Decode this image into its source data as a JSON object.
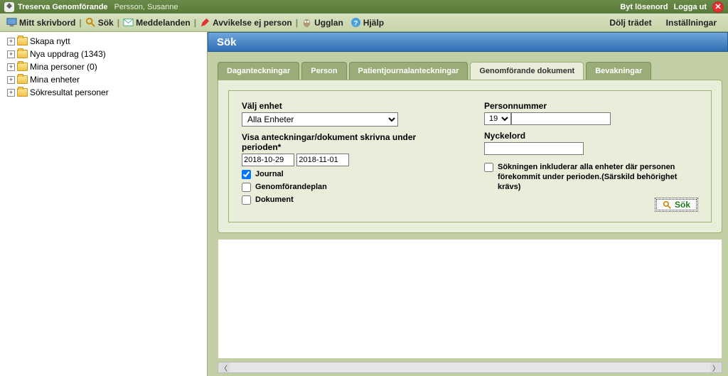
{
  "titlebar": {
    "app_name": "Treserva Genomförande",
    "user": "Persson, Susanne",
    "change_password": "Byt lösenord",
    "logout": "Logga ut"
  },
  "toolbar": {
    "desktop": "Mitt skrivbord",
    "search": "Sök",
    "messages": "Meddelanden",
    "deviation": "Avvikelse ej person",
    "owl": "Ugglan",
    "help": "Hjälp",
    "hide_tree": "Dölj trädet",
    "settings": "Inställningar"
  },
  "tree": {
    "items": [
      {
        "label": "Skapa nytt"
      },
      {
        "label": "Nya uppdrag (1343)"
      },
      {
        "label": "Mina personer (0)"
      },
      {
        "label": "Mina enheter"
      },
      {
        "label": "Sökresultat personer"
      }
    ]
  },
  "panel": {
    "title": "Sök"
  },
  "tabs": {
    "items": [
      {
        "label": "Daganteckningar"
      },
      {
        "label": "Person"
      },
      {
        "label": "Patientjournalanteckningar"
      },
      {
        "label": "Genomförande dokument"
      },
      {
        "label": "Bevakningar"
      }
    ],
    "active": 3
  },
  "form": {
    "unit_label": "Välj enhet",
    "unit_value": "Alla Enheter",
    "period_label": "Visa anteckningar/dokument skrivna under perioden*",
    "date_from": "2018-10-29",
    "date_to": "2018-11-01",
    "journal": "Journal",
    "plan": "Genomförandeplan",
    "document": "Dokument",
    "personnummer_label": "Personnummer",
    "pn_prefix": "19",
    "pn_value": "",
    "keyword_label": "Nyckelord",
    "keyword_value": "",
    "include_all_units": "Sökningen inkluderar alla enheter där personen förekommit under perioden.(Särskild behörighet krävs)",
    "search_button": "Sök"
  }
}
